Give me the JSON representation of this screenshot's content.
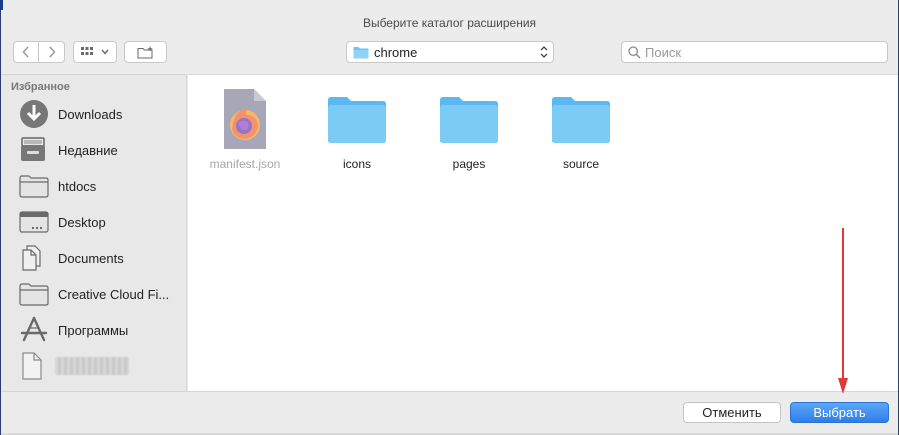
{
  "window": {
    "title": "Выберите каталог расширения"
  },
  "toolbar": {
    "path_selected": "chrome",
    "search_placeholder": "Поиск"
  },
  "sidebar": {
    "heading": "Избранное",
    "items": [
      {
        "label": "Downloads",
        "icon": "downloads-icon"
      },
      {
        "label": "Недавние",
        "icon": "recents-icon"
      },
      {
        "label": "htdocs",
        "icon": "folder-icon"
      },
      {
        "label": "Desktop",
        "icon": "desktop-icon"
      },
      {
        "label": "Documents",
        "icon": "documents-icon"
      },
      {
        "label": "Creative Cloud Fi...",
        "icon": "folder-icon"
      },
      {
        "label": "Программы",
        "icon": "applications-icon"
      },
      {
        "label": "",
        "icon": "document-icon"
      }
    ]
  },
  "files": [
    {
      "name": "manifest.json",
      "type": "file",
      "icon": "firefox-document-icon",
      "dimmed": true
    },
    {
      "name": "icons",
      "type": "folder",
      "icon": "folder-icon",
      "dimmed": false
    },
    {
      "name": "pages",
      "type": "folder",
      "icon": "folder-icon",
      "dimmed": false
    },
    {
      "name": "source",
      "type": "folder",
      "icon": "folder-icon",
      "dimmed": false
    }
  ],
  "footer": {
    "cancel_label": "Отменить",
    "choose_label": "Выбрать"
  },
  "colors": {
    "accent": "#2f7ee8",
    "folder": "#6ec3f5",
    "annotation_arrow": "#e0393a"
  }
}
